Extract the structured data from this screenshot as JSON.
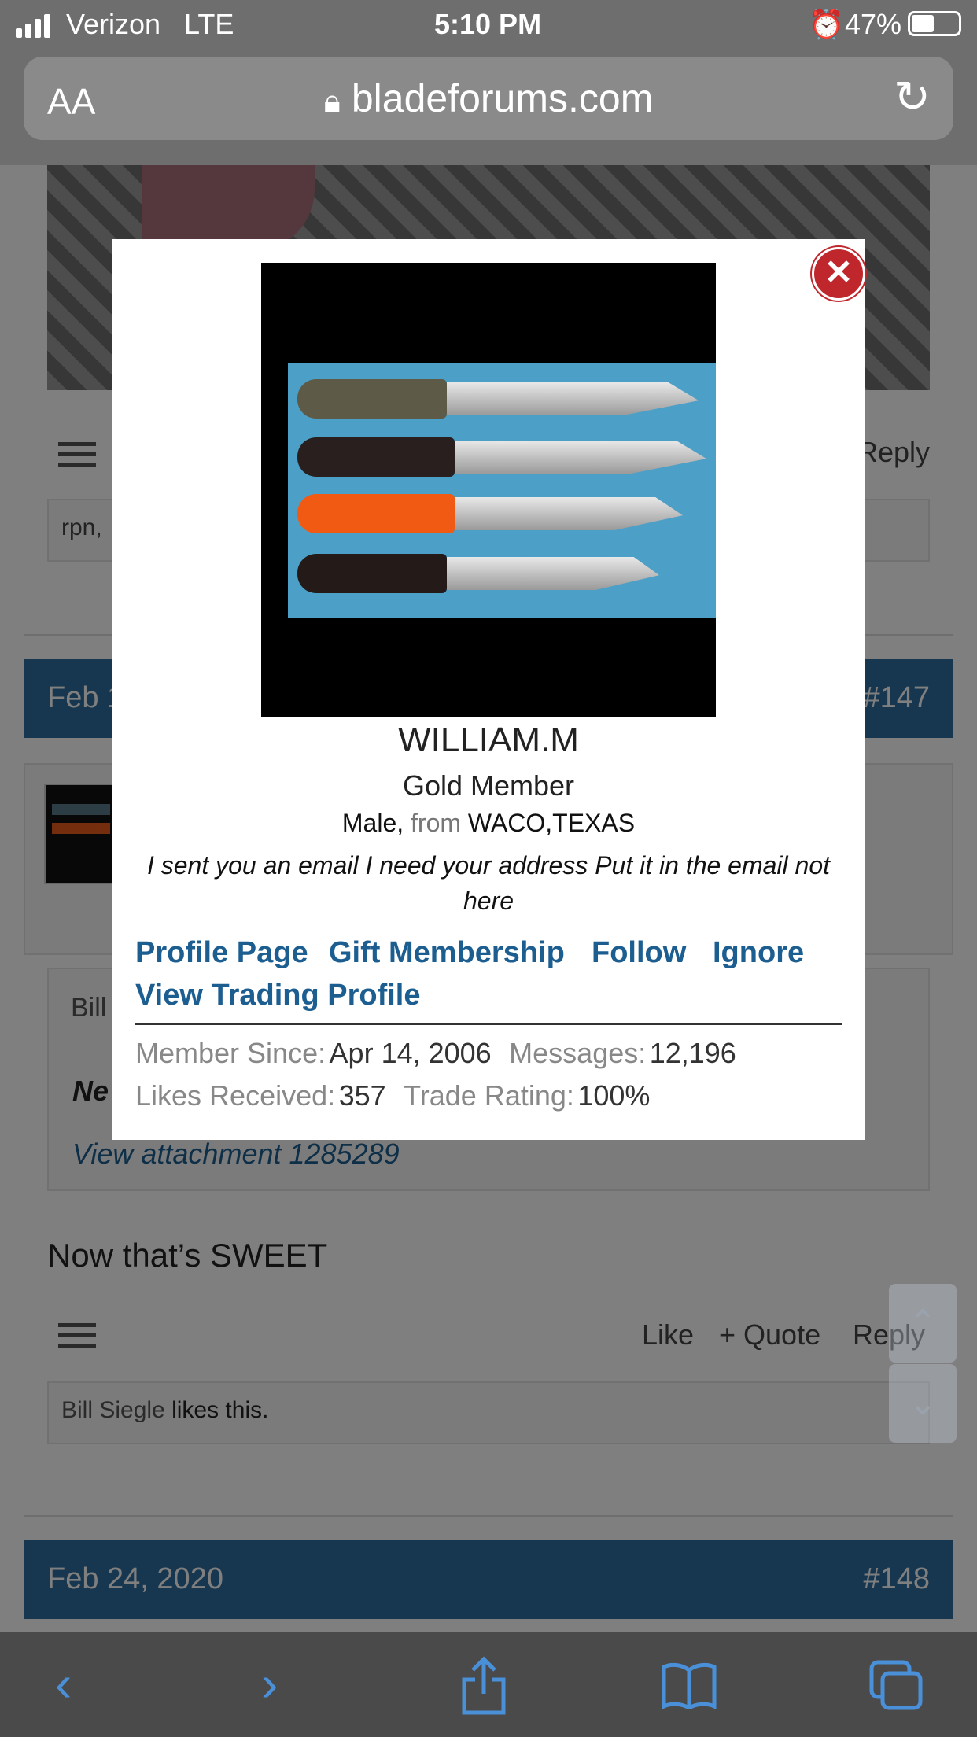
{
  "status_bar": {
    "carrier": "Verizon",
    "network": "LTE",
    "time": "5:10 PM",
    "battery": "47%"
  },
  "url_bar": {
    "text_size": "AA",
    "domain": "bladeforums.com"
  },
  "background": {
    "post_reply_label": "Reply",
    "likes_snippet": "rpn,",
    "post1_date": "Feb 1",
    "post1_number": "#147",
    "quote_author": "Bill",
    "quote_text": "Ne",
    "attachment_text": "View attachment 1285289",
    "post2_text": "Now that’s SWEET",
    "post2_actions": {
      "like": "Like",
      "quote": "+ Quote",
      "reply": "Reply"
    },
    "likes_name": "Bill Siegle",
    "likes_suffix": "likes this.",
    "post3_date": "Feb 24, 2020",
    "post3_number": "#148"
  },
  "modal": {
    "username": "WILLIAM.M",
    "user_title": "Gold Member",
    "gender": "Male,",
    "from_label": "from",
    "location": "WACO,TEXAS",
    "status_message": "I sent you an email I need your address Put it in the email not here",
    "links": [
      "Profile Page",
      "Gift Membership",
      "Follow",
      "Ignore",
      "View Trading Profile"
    ],
    "stats": {
      "member_since_label": "Member Since:",
      "member_since": "Apr 14, 2006",
      "messages_label": "Messages:",
      "messages": "12,196",
      "likes_label": "Likes Received:",
      "likes": "357",
      "trade_label": "Trade Rating:",
      "trade": "100%"
    },
    "close_icon": "close-icon"
  },
  "toolbar": {
    "icons": [
      "back-icon",
      "forward-icon",
      "share-icon",
      "bookmarks-icon",
      "tabs-icon"
    ]
  },
  "colors": {
    "accent": "#2f6fa0",
    "link": "#1d5e91",
    "close": "#c0272d"
  }
}
